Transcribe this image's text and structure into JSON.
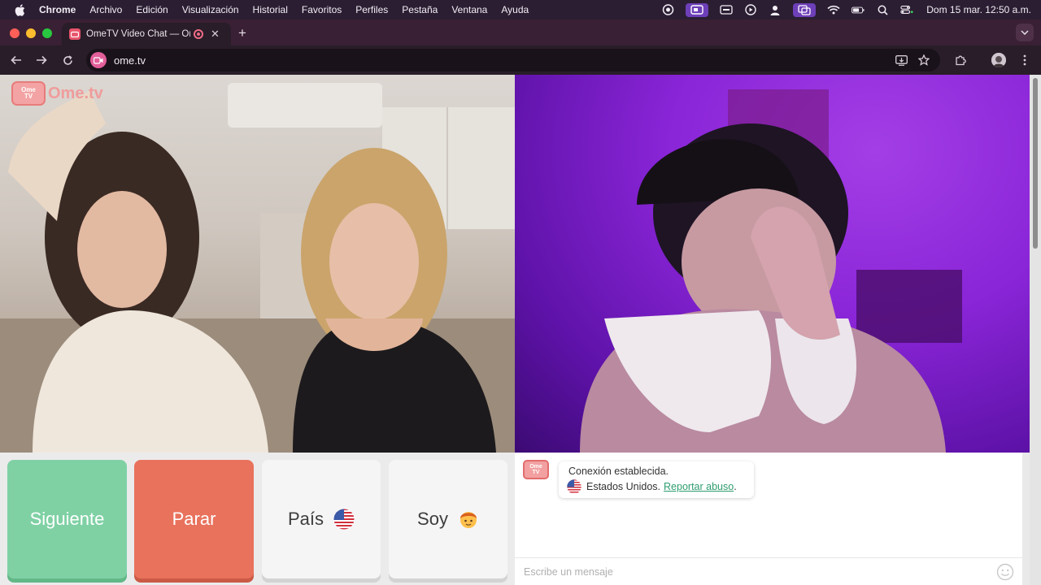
{
  "menubar": {
    "app_name": "Chrome",
    "items": [
      "Archivo",
      "Edición",
      "Visualización",
      "Historial",
      "Favoritos",
      "Perfiles",
      "Pestaña",
      "Ventana",
      "Ayuda"
    ],
    "clock": "Dom 15 mar.  12:50 a.m."
  },
  "browser": {
    "tab_title": "OmeTV Video Chat — Ome",
    "url": "ome.tv"
  },
  "logo": {
    "badge_top": "Ome",
    "badge_bottom": "TV",
    "brand": "Ome.tv"
  },
  "controls": {
    "next_label": "Siguiente",
    "stop_label": "Parar",
    "country_label": "País",
    "gender_label": "Soy"
  },
  "chat": {
    "status": "Conexión establecida.",
    "country": "Estados Unidos.",
    "report_link": "Reportar abuso",
    "report_suffix": ".",
    "placeholder": "Escribe un mensaje"
  },
  "colors": {
    "next": "#7fd1a4",
    "stop": "#e9725c",
    "link": "#2e9c6e",
    "brand": "#f09c9c"
  }
}
